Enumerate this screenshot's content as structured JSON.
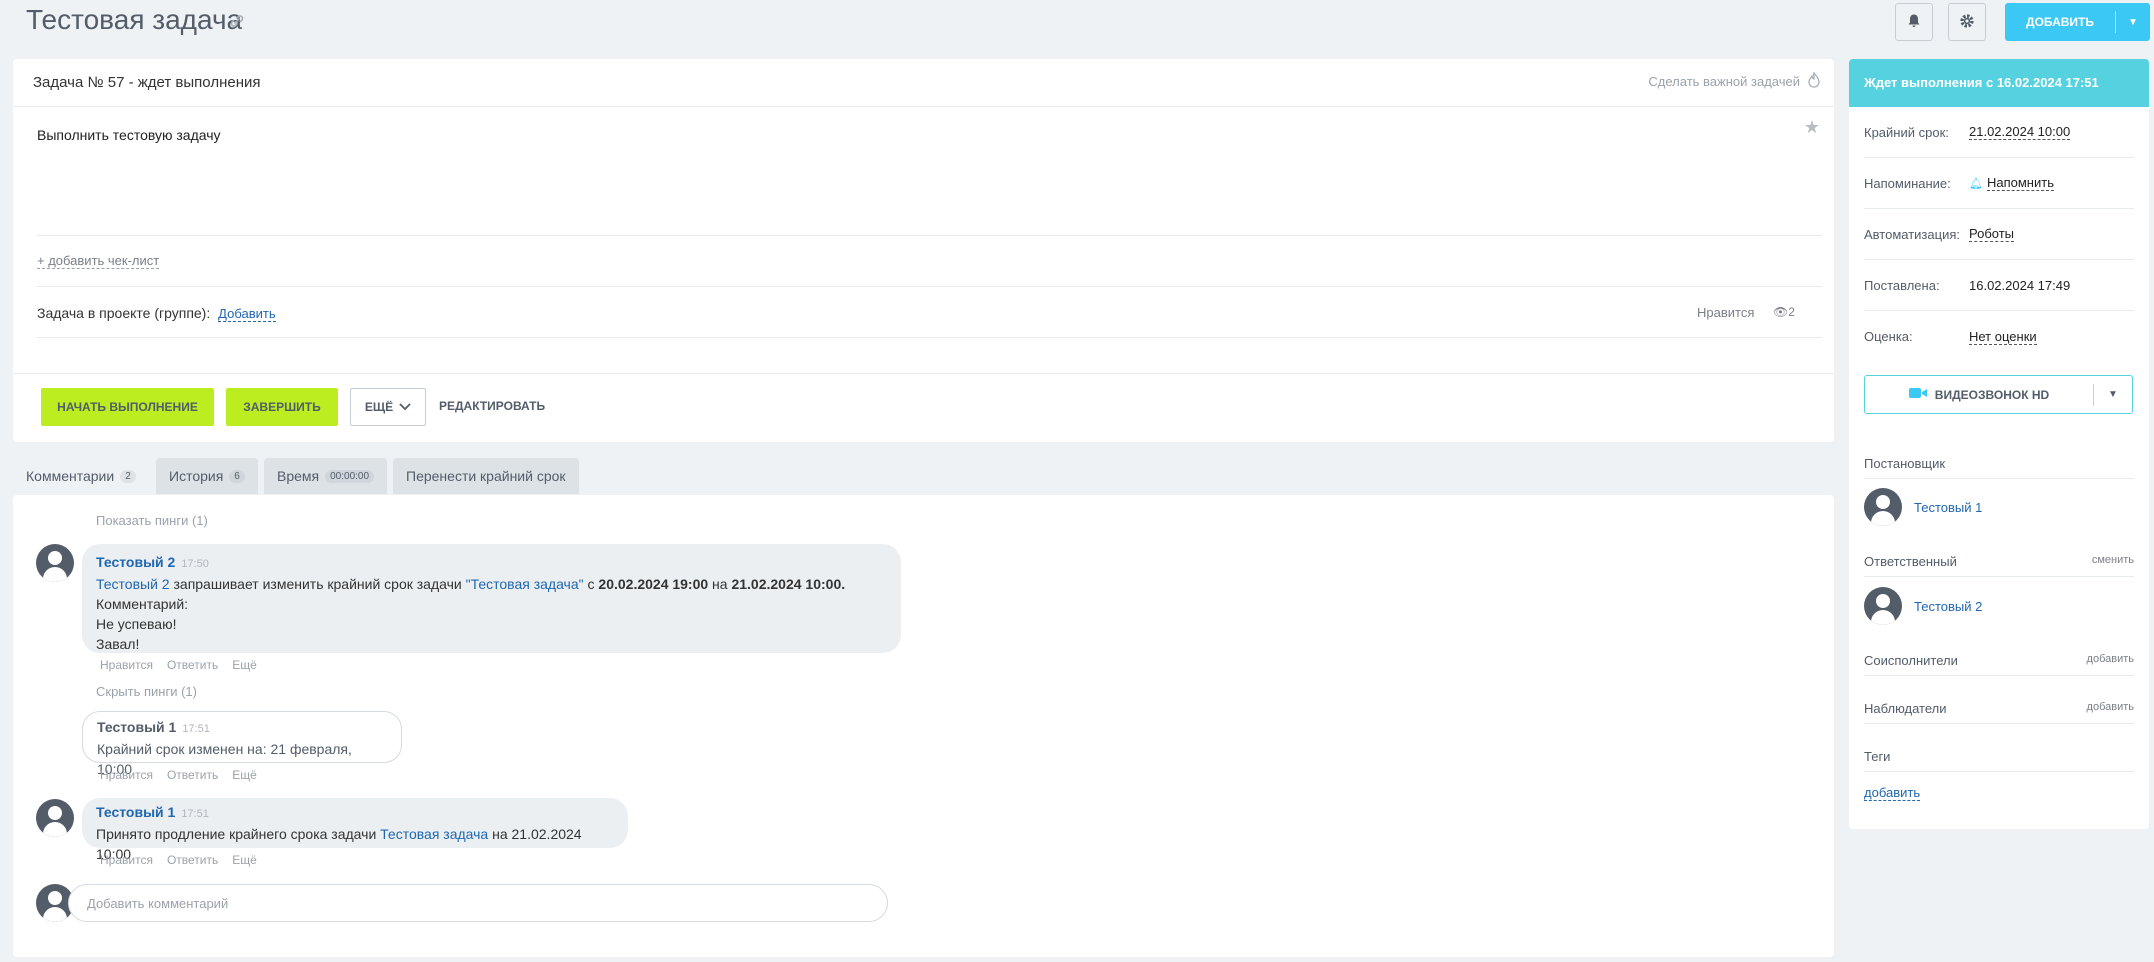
{
  "header": {
    "title": "Тестовая задача",
    "add_label": "ДОБАВИТЬ"
  },
  "task": {
    "number_status": "Задача № 57 - ждет выполнения",
    "important_label": "Сделать важной задачей",
    "description": "Выполнить тестовую задачу",
    "add_checklist": "+ добавить чек-лист",
    "project_label": "Задача в проекте (группе):",
    "project_add": "Добавить",
    "likes_label": "Нравится",
    "views_count": "2",
    "buttons": {
      "start": "НАЧАТЬ ВЫПОЛНЕНИЕ",
      "finish": "ЗАВЕРШИТЬ",
      "more": "ЕЩЁ",
      "edit": "РЕДАКТИРОВАТЬ"
    }
  },
  "tabs": [
    {
      "label": "Комментарии",
      "count": "2"
    },
    {
      "label": "История",
      "count": "6"
    },
    {
      "label": "Время",
      "count": "00:00:00"
    },
    {
      "label": "Перенести крайний срок",
      "count": ""
    }
  ],
  "comments": {
    "show_pings": "Показать пинги (1)",
    "hide_pings": "Скрыть пинги (1)",
    "c1": {
      "author": "Тестовый 2",
      "time": "17:50",
      "line1_author": "Тестовый 2",
      "line1_text": " запрашивает изменить крайний срок задачи ",
      "line1_link": "\"Тестовая задача\"",
      "line1_from": " с ",
      "line1_date1": "20.02.2024 19:00",
      "line1_to": " на ",
      "line1_date2": "21.02.2024 10:00.",
      "line2": "Комментарий:",
      "line3": "Не успеваю!",
      "line4": "Завал!"
    },
    "c2": {
      "author": "Тестовый 1",
      "time": "17:51",
      "text": "Крайний срок изменен на: 21 февраля, 10:00"
    },
    "c3": {
      "author": "Тестовый 1",
      "time": "17:51",
      "text_before": "Принято продление крайнего срока задачи ",
      "link": "Тестовая задача",
      "text_after": " на 21.02.2024 10:00"
    },
    "action_like": "Нравится",
    "action_reply": "Ответить",
    "action_more": "Ещё",
    "input_placeholder": "Добавить комментарий"
  },
  "side": {
    "status": "Ждет выполнения с 16.02.2024 17:51",
    "deadline_label": "Крайний срок:",
    "deadline_value": "21.02.2024 10:00",
    "reminder_label": "Напоминание:",
    "reminder_value": "Напомнить",
    "automation_label": "Автоматизация:",
    "automation_value": "Роботы",
    "created_label": "Поставлена:",
    "created_value": "16.02.2024 17:49",
    "rating_label": "Оценка:",
    "rating_value": "Нет оценки",
    "video_label": "ВИДЕОЗВОНОК HD",
    "creator_head": "Постановщик",
    "creator_name": "Тестовый 1",
    "responsible_head": "Ответственный",
    "responsible_action": "сменить",
    "responsible_name": "Тестовый 2",
    "accomplices_head": "Соисполнители",
    "accomplices_action": "добавить",
    "auditors_head": "Наблюдатели",
    "auditors_action": "добавить",
    "tags_head": "Теги",
    "tags_add": "добавить"
  },
  "colors": {
    "accent": "#3bc8f5",
    "status": "#56d1e0",
    "green": "#bbed21",
    "link": "#2067b0"
  }
}
